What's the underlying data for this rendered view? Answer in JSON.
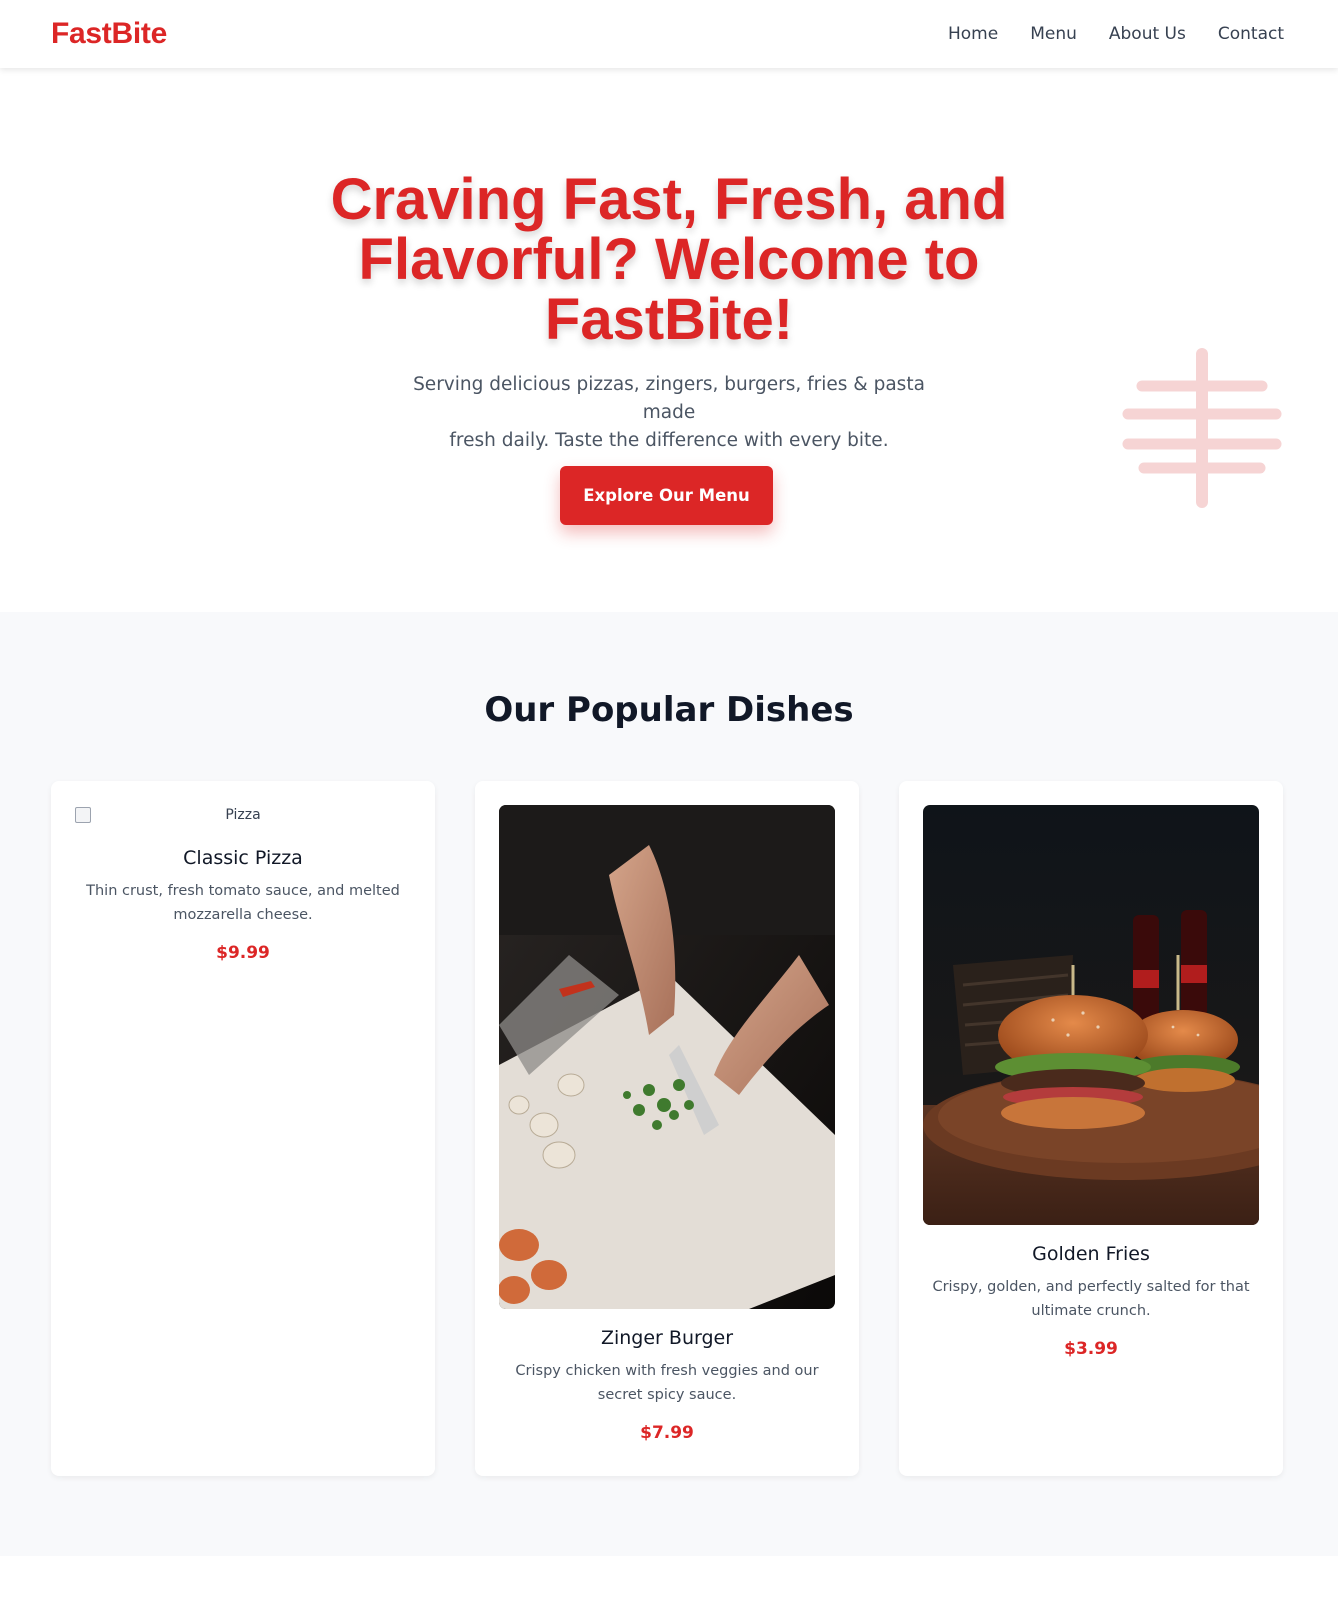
{
  "nav": {
    "brand": "FastBite",
    "links": [
      "Home",
      "Menu",
      "About Us",
      "Contact"
    ]
  },
  "hero": {
    "title_lines": [
      "Craving Fast, Fresh, and",
      "Flavorful? Welcome to",
      "FastBite!"
    ],
    "subtitle_lines": [
      "Serving delicious pizzas, zingers, burgers, fries & pasta made",
      "fresh daily. Taste the difference with every bite."
    ],
    "cta_label": "Explore Our Menu",
    "deco_icon": "utensils-icon"
  },
  "dishes": {
    "title": "Our Popular Dishes",
    "items": [
      {
        "image_alt": "Pizza",
        "image_state": "broken",
        "name": "Classic Pizza",
        "description_lines": [
          "Thin crust, fresh tomato sauce, and melted",
          "mozzarella cheese."
        ],
        "price": "$9.99"
      },
      {
        "image_alt": "chef chopping vegetables",
        "name": "Zinger Burger",
        "description_lines": [
          "Crispy chicken with fresh veggies and our",
          "secret spicy sauce."
        ],
        "price": "$7.99"
      },
      {
        "image_alt": "burgers on wooden board",
        "name": "Golden Fries",
        "description_lines": [
          "Crispy, golden, and perfectly salted for that",
          "ultimate crunch."
        ],
        "price": "$3.99"
      }
    ]
  },
  "colors": {
    "brand_red": "#dc2626",
    "section_bg": "#f8f9fb",
    "deco_pink": "#f6d4d4"
  }
}
